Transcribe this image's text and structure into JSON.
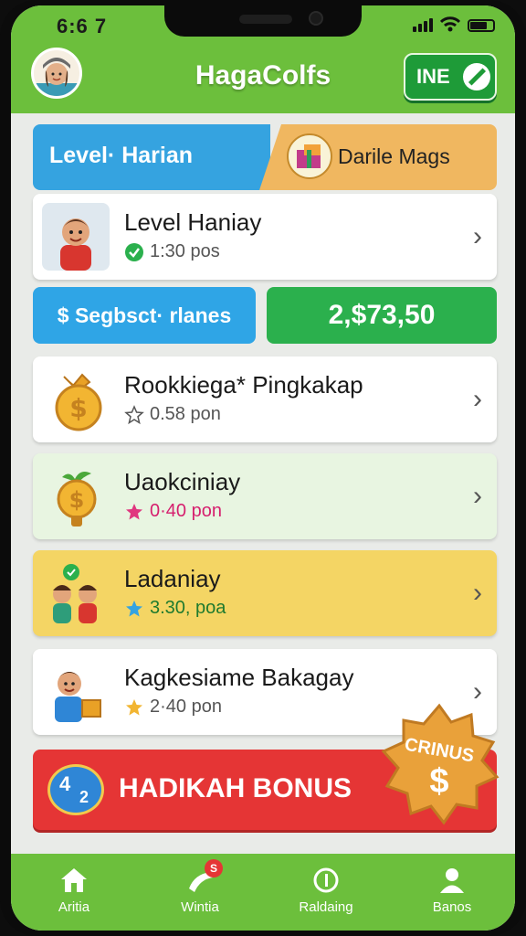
{
  "status_bar": {
    "time": "6:6 7"
  },
  "header": {
    "title": "HagaColfs",
    "button_label": "INE"
  },
  "segments": {
    "left_label": "Level· Harian",
    "right_label": "Darile Mags"
  },
  "cards": [
    {
      "title": "Level Haniay",
      "subtitle": "1:30 pos",
      "bg": "#ffffff"
    },
    {
      "title": "Rookkiega* Pingkakap",
      "subtitle": "0.58 pon",
      "bg": "#ffffff"
    },
    {
      "title": "Uaokciniay",
      "subtitle": "0·40 pon",
      "bg": "#e8f5e1"
    },
    {
      "title": "Ladaniay",
      "subtitle": "3.30, poa",
      "bg": "#f4d564"
    },
    {
      "title": "Kagkesiame Bakagay",
      "subtitle": "2·40 pon",
      "bg": "#ffffff"
    }
  ],
  "pills": {
    "left_label": "$ Segbsct· rlanes",
    "right_value": "2,$73,50"
  },
  "bonus": {
    "label": "HADIKAH BONUS",
    "badge_text": "CRINUS",
    "badge_symbol": "$",
    "num_top": "4",
    "num_bottom": "2"
  },
  "nav": [
    {
      "label": "Aritia",
      "icon": "home-icon"
    },
    {
      "label": "Wintia",
      "icon": "boomerang-icon",
      "badge": "S"
    },
    {
      "label": "Raldaing",
      "icon": "ring-icon"
    },
    {
      "label": "Banos",
      "icon": "person-icon"
    }
  ],
  "colors": {
    "primary_green": "#6cbf3c",
    "blue": "#2fa5e6",
    "money_green": "#2bb04d",
    "bonus_red": "#e53535",
    "gold": "#f0b760"
  }
}
